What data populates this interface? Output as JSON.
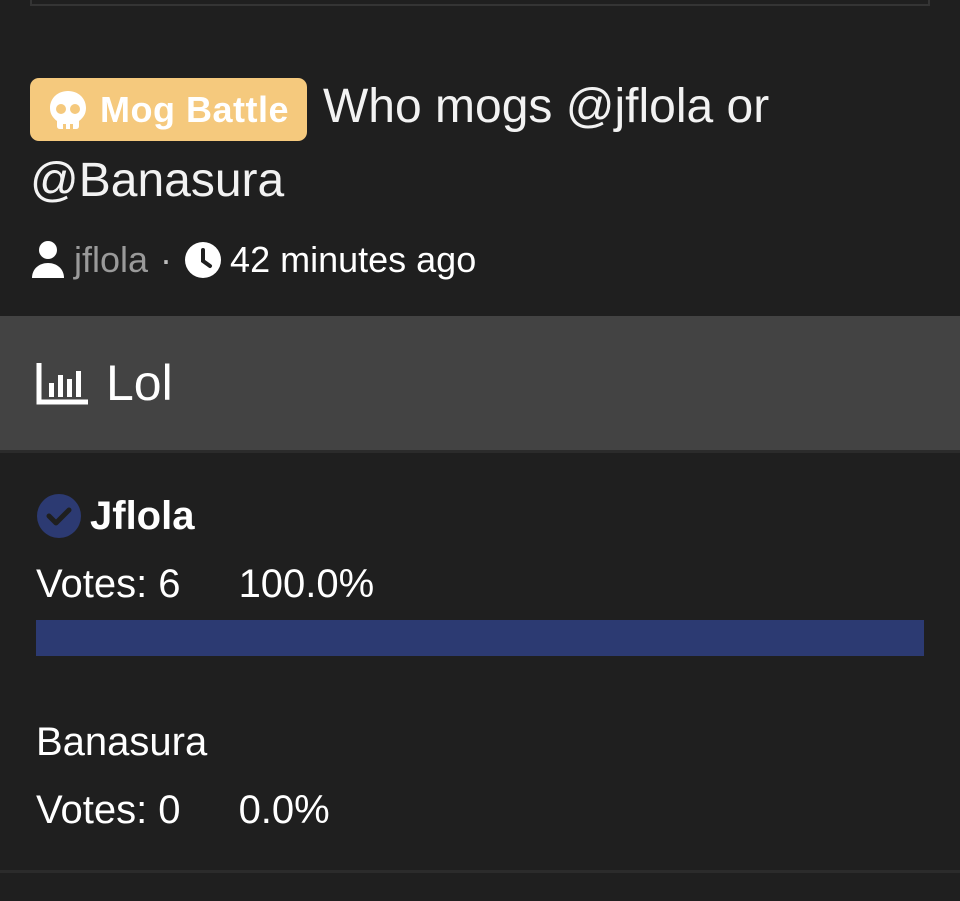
{
  "post": {
    "flair": {
      "label": "Mog Battle",
      "icon": "skull-icon",
      "bg_color": "#f5c97d"
    },
    "title": "Who mogs @jflola or @Banasura",
    "author": "jflola",
    "separator": "·",
    "time_ago": "42 minutes ago"
  },
  "poll": {
    "title": "Lol",
    "icon": "bar-chart-icon",
    "accent_color": "#2c3a72",
    "options": [
      {
        "name": "Jflola",
        "votes_label": "Votes: 6",
        "percent_label": "100.0%",
        "percent": 100.0,
        "selected": true,
        "check_icon": "check-circle-icon"
      },
      {
        "name": "Banasura",
        "votes_label": "Votes: 0",
        "percent_label": "0.0%",
        "percent": 0.0,
        "selected": false
      }
    ]
  }
}
